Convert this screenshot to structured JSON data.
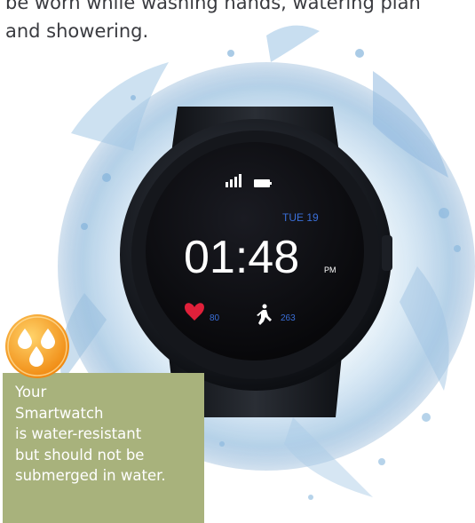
{
  "intro": {
    "line1": "be worn while washing hands, watering plan",
    "line2": "and showering."
  },
  "watch": {
    "date": "TUE 19",
    "time": "01:48",
    "ampm": "PM",
    "heart_value": "80",
    "steps_value": "263"
  },
  "tip": {
    "icon": "water-drops-icon",
    "lines": [
      "Your",
      "Smartwatch",
      "is water-resistant",
      "but should not be",
      "submerged in water."
    ]
  },
  "colors": {
    "tip_box": "#a8b27c",
    "tip_icon": "#f5a623",
    "screen_bg": "#0c0c10",
    "heart": "#e0203a",
    "accent_blue": "#3a6fd8"
  }
}
